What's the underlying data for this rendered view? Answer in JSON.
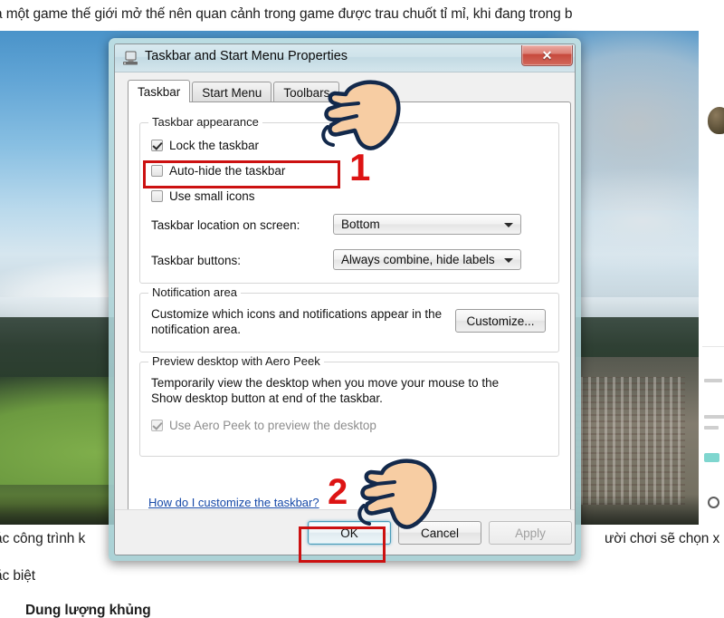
{
  "article": {
    "top_line": "à một game thế giới mở thế nên quan cảnh trong game được trau chuốt tỉ mỉ, khi đang trong b",
    "bottom_left": "ác công trình k",
    "bottom_right": "ười chơi sẽ chọn x",
    "bottom_line2": "ặc biệt",
    "bottom_heading": "Dung lượng khủng"
  },
  "dialog": {
    "title": "Taskbar and Start Menu Properties",
    "window_icon": "monitor-icon",
    "close_label": "✕",
    "tabs": [
      {
        "label": "Taskbar",
        "active": true
      },
      {
        "label": "Start Menu",
        "active": false
      },
      {
        "label": "Toolbars",
        "active": false
      }
    ],
    "appearance": {
      "legend": "Taskbar appearance",
      "checkboxes": [
        {
          "label": "Lock the taskbar",
          "checked": true,
          "disabled": false
        },
        {
          "label": "Auto-hide the taskbar",
          "checked": false,
          "disabled": false
        },
        {
          "label": "Use small icons",
          "checked": false,
          "disabled": false
        }
      ],
      "location_label": "Taskbar location on screen:",
      "location_value": "Bottom",
      "buttons_label": "Taskbar buttons:",
      "buttons_value": "Always combine, hide labels"
    },
    "notification": {
      "legend": "Notification area",
      "description_line1": "Customize which icons and notifications appear in the",
      "description_line2": "notification area.",
      "customize_button": "Customize..."
    },
    "aero": {
      "legend": "Preview desktop with Aero Peek",
      "description_line1": "Temporarily view the desktop when you move your mouse to the",
      "description_line2": "Show desktop button at end of the taskbar.",
      "checkbox_label": "Use Aero Peek to preview the desktop",
      "checkbox_checked": true,
      "checkbox_disabled": true
    },
    "help_link": "How do I customize the taskbar?",
    "footer_buttons": {
      "ok": "OK",
      "cancel": "Cancel",
      "apply": "Apply"
    }
  },
  "annotations": {
    "step1_number": "1",
    "step2_number": "2",
    "highlight_color": "#cc1111",
    "number_color": "#dd1414",
    "hand_skin_color": "#f7cda3",
    "hand_outline_color": "#13294b"
  }
}
